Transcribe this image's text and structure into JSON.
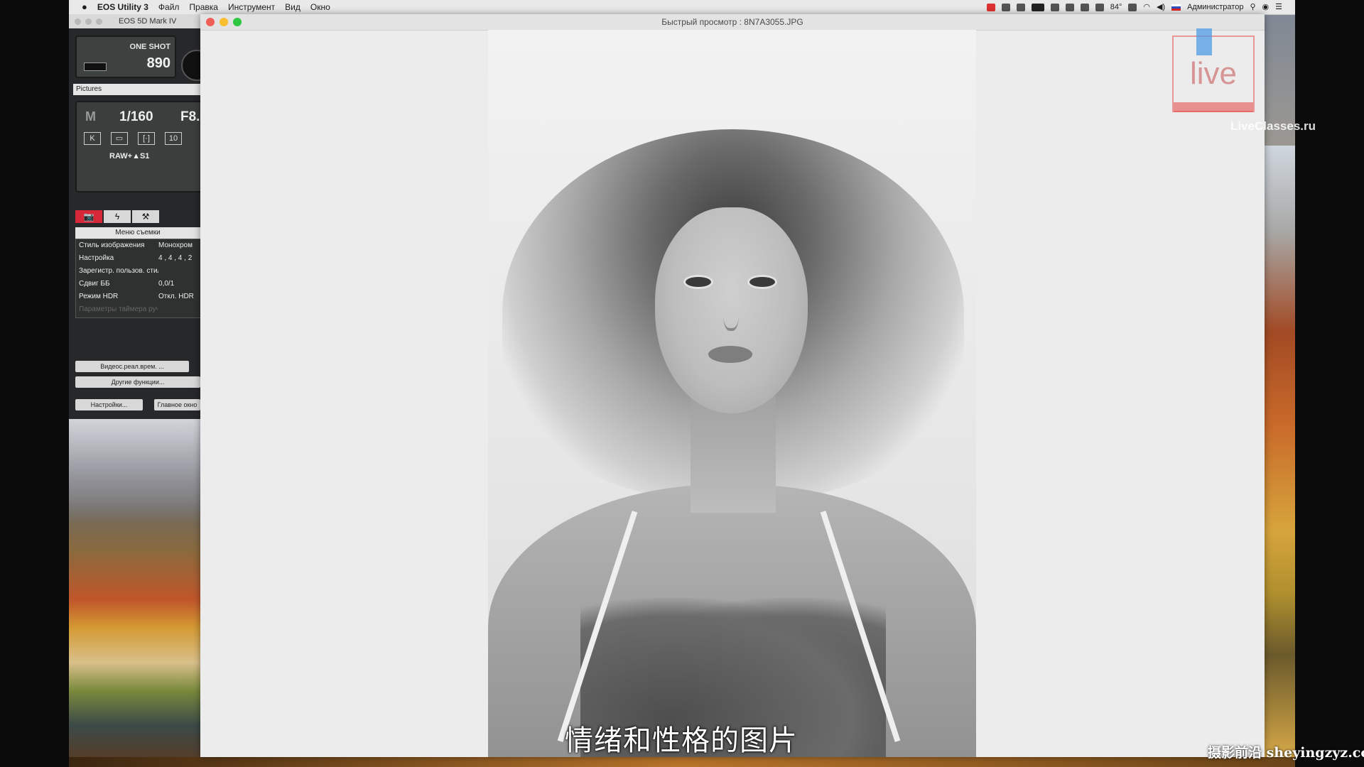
{
  "menubar": {
    "app_name": "EOS Utility 3",
    "menus": [
      "Файл",
      "Правка",
      "Инструмент",
      "Вид",
      "Окно"
    ],
    "status_temp": "84°",
    "user": "Администратор"
  },
  "eos": {
    "window_title": "EOS 5D Mark IV",
    "af_mode": "ONE SHOT",
    "shots_remaining": "890",
    "folder_label": "Pictures",
    "mode": "M",
    "shutter": "1/160",
    "aperture": "F8.",
    "iso_partial": "10",
    "quality": "RAW+▲S1",
    "tabs": [
      "📷",
      "ϟ",
      "⚒"
    ],
    "menu_title": "Меню съемки",
    "menu_rows": [
      {
        "key": "Стиль изображения",
        "value": "Монохром"
      },
      {
        "key": "Настройка",
        "value": "4 , 4 , 4 , 2"
      },
      {
        "key": "Зарегистр. пользов. стиль",
        "value": ""
      },
      {
        "key": "Сдвиг ББ",
        "value": "0,0/1"
      },
      {
        "key": "Режим HDR",
        "value": "Откл. HDR"
      },
      {
        "key": "Параметры таймера руч.видеосъемки",
        "value": ""
      }
    ],
    "btn_liveview": "Видеос.реал.врем. ...",
    "btn_other": "Другие функции...",
    "btn_settings": "Настройки...",
    "btn_main": "Главное окно"
  },
  "quicklook": {
    "title": "Быстрый просмотр : 8N7A3055.JPG"
  },
  "overlay": {
    "logo_text": "live",
    "site_text": "LiveClasses.ru",
    "subtitle": "情绪和性格的图片",
    "watermark": "摄影前沿 sheyingzyz.com"
  }
}
